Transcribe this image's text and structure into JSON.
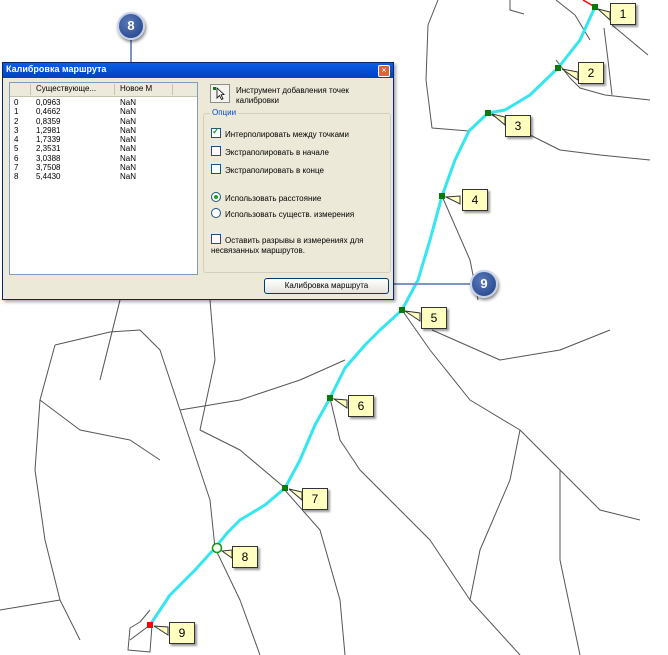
{
  "dialog": {
    "title": "Калибровка маршрута",
    "close_glyph": "×",
    "table": {
      "headers": [
        "Существующе...",
        "Новое M"
      ],
      "rows": [
        {
          "idx": "0",
          "existing": "0,0963",
          "new": "NaN"
        },
        {
          "idx": "1",
          "existing": "0,4662",
          "new": "NaN"
        },
        {
          "idx": "2",
          "existing": "0,8359",
          "new": "NaN"
        },
        {
          "idx": "3",
          "existing": "1,2981",
          "new": "NaN"
        },
        {
          "idx": "4",
          "existing": "1,7339",
          "new": "NaN"
        },
        {
          "idx": "5",
          "existing": "2,3531",
          "new": "NaN"
        },
        {
          "idx": "6",
          "existing": "3,0388",
          "new": "NaN"
        },
        {
          "idx": "7",
          "existing": "3,7508",
          "new": "NaN"
        },
        {
          "idx": "8",
          "existing": "5,4430",
          "new": "NaN"
        }
      ]
    },
    "tool_label": "Инструмент добавления точек калибровки",
    "options": {
      "legend": "Опции",
      "interpolate": {
        "label": "Интерполировать между точками",
        "checked": true
      },
      "extrapolate_start": {
        "label": "Экстраполировать в начале",
        "checked": false
      },
      "extrapolate_end": {
        "label": "Экстраполировать в конце",
        "checked": false
      },
      "use_distance": {
        "label": "Использовать расстояние",
        "selected": true
      },
      "use_existing": {
        "label": "Использовать существ. измерения",
        "selected": false
      },
      "keep_gaps": {
        "label": "Оставить разрывы в измерениях для несвязанных маршрутов.",
        "checked": false
      }
    },
    "calibrate_button": "Калибровка маршрута"
  },
  "step_badges": [
    "8",
    "9"
  ],
  "map_callouts": [
    "1",
    "2",
    "3",
    "4",
    "5",
    "6",
    "7",
    "8",
    "9"
  ],
  "colors": {
    "route": "#33e6f0",
    "road": "#555555",
    "point": "#0a7a0a",
    "end_point": "#ff0000",
    "callout_bg": "#ffffc0",
    "title_bar": "#0a5ee6"
  }
}
